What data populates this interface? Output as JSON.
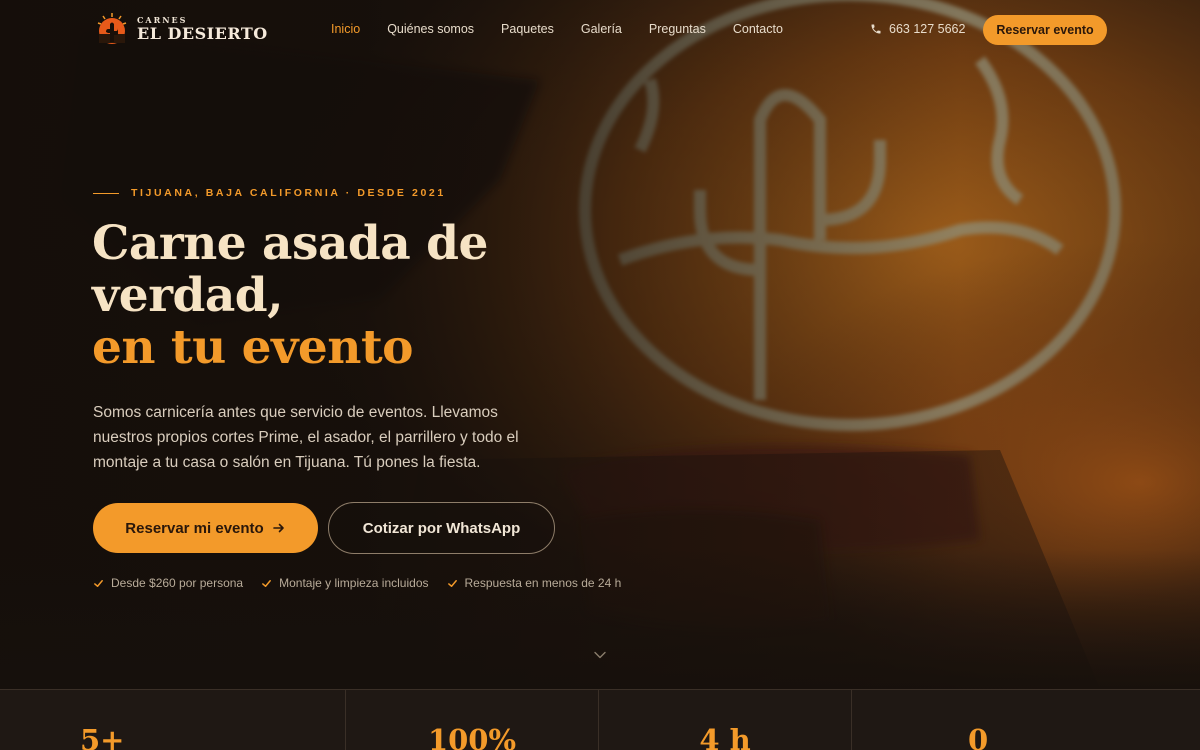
{
  "brand": {
    "top": "CARNES",
    "name": "EL DESIERTO"
  },
  "nav": {
    "links": [
      "Inicio",
      "Quiénes somos",
      "Paquetes",
      "Galería",
      "Preguntas",
      "Contacto"
    ],
    "phone": "663 127 5662",
    "cta": "Reservar evento"
  },
  "hero": {
    "eyebrow": "TIJUANA, BAJA CALIFORNIA · DESDE 2021",
    "headline_1": "Carne asada de",
    "headline_2": "verdad,",
    "headline_3": "en tu evento",
    "lede": "Somos carnicería antes que servicio de eventos. Llevamos nuestros propios cortes Prime, el asador, el parrillero y todo el montaje a tu casa o salón en Tijuana. Tú pones la fiesta.",
    "primary_cta": "Reservar mi evento",
    "secondary_cta": "Cotizar por WhatsApp",
    "perks": [
      "Desde $260 por persona",
      "Montaje y limpieza incluidos",
      "Respuesta en menos de 24 h"
    ]
  },
  "stats": [
    "5+",
    "100%",
    "4 h",
    "0"
  ],
  "icons": {
    "logo": "cactus-sun-logo",
    "phone": "phone-icon",
    "arrow": "arrow-right-icon",
    "check": "check-icon",
    "scroll": "chevron-down-icon"
  },
  "colors": {
    "accent": "#f39a2a",
    "background": "#16100c",
    "cream": "#f6e3c4"
  }
}
